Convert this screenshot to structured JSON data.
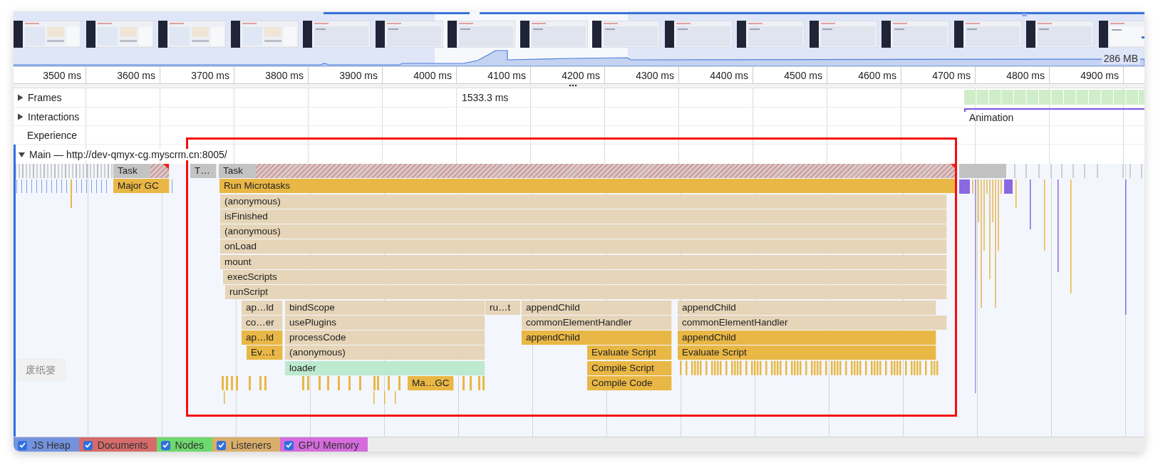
{
  "overview": {
    "thumbnails": [
      {
        "kind": "dashboard"
      },
      {
        "kind": "dashboard"
      },
      {
        "kind": "dashboard"
      },
      {
        "kind": "dashboard"
      },
      {
        "kind": "list"
      },
      {
        "kind": "list"
      },
      {
        "kind": "list"
      },
      {
        "kind": "list"
      },
      {
        "kind": "list"
      },
      {
        "kind": "list"
      },
      {
        "kind": "list"
      },
      {
        "kind": "list"
      },
      {
        "kind": "list"
      },
      {
        "kind": "list"
      },
      {
        "kind": "list"
      },
      {
        "kind": "detail"
      }
    ],
    "memory_reading": "286 MB"
  },
  "ruler": {
    "ticks": [
      "3500 ms",
      "3600 ms",
      "3700 ms",
      "3800 ms",
      "3900 ms",
      "4000 ms",
      "4100 ms",
      "4200 ms",
      "4300 ms",
      "4400 ms",
      "4500 ms",
      "4600 ms",
      "4700 ms",
      "4800 ms",
      "4900 ms"
    ]
  },
  "tracks": [
    {
      "label": "Frames",
      "kind": "frames",
      "expanded": false,
      "reading": "1533.3 ms"
    },
    {
      "label": "Interactions",
      "kind": "interactions",
      "expanded": false,
      "event": "Animation"
    },
    {
      "label": "Experience",
      "kind": "experience"
    }
  ],
  "main": {
    "title": "Main — http://dev-qmyx-cg.myscrm.cn:8005/",
    "expanded": true,
    "rows": [
      {
        "bars": [
          {
            "label": "Task",
            "kind": "task",
            "long": true
          },
          {
            "label": "T…",
            "kind": "task",
            "long": false
          },
          {
            "label": "Task",
            "kind": "task",
            "long": true
          }
        ]
      },
      {
        "bars": [
          {
            "label": "Major GC",
            "kind": "native"
          },
          {
            "label": "Run Microtasks",
            "kind": "native"
          }
        ]
      },
      {
        "bars": [
          {
            "label": "(anonymous)",
            "kind": "script"
          }
        ]
      },
      {
        "bars": [
          {
            "label": "isFinished",
            "kind": "script"
          }
        ]
      },
      {
        "bars": [
          {
            "label": "(anonymous)",
            "kind": "script"
          }
        ]
      },
      {
        "bars": [
          {
            "label": "onLoad",
            "kind": "script"
          }
        ]
      },
      {
        "bars": [
          {
            "label": "mount",
            "kind": "script"
          }
        ]
      },
      {
        "bars": [
          {
            "label": "execScripts",
            "kind": "script"
          }
        ]
      },
      {
        "bars": [
          {
            "label": "runScript",
            "kind": "script"
          }
        ]
      },
      {
        "bars": [
          {
            "label": "ap…ld",
            "kind": "script"
          },
          {
            "label": "bindScope",
            "kind": "script"
          },
          {
            "label": "ru…t",
            "kind": "script"
          },
          {
            "label": "appendChild",
            "kind": "script"
          },
          {
            "label": "appendChild",
            "kind": "script"
          }
        ]
      },
      {
        "bars": [
          {
            "label": "co…er",
            "kind": "script"
          },
          {
            "label": "usePlugins",
            "kind": "script"
          },
          {
            "label": "commonElementHandler",
            "kind": "script"
          },
          {
            "label": "commonElementHandler",
            "kind": "script"
          }
        ]
      },
      {
        "bars": [
          {
            "label": "ap…ld",
            "kind": "native"
          },
          {
            "label": "processCode",
            "kind": "script"
          },
          {
            "label": "appendChild",
            "kind": "native"
          },
          {
            "label": "appendChild",
            "kind": "native"
          }
        ]
      },
      {
        "bars": [
          {
            "label": "Ev…t",
            "kind": "native"
          },
          {
            "label": "(anonymous)",
            "kind": "script"
          },
          {
            "label": "Evaluate Script",
            "kind": "native"
          },
          {
            "label": "Evaluate Script",
            "kind": "native"
          }
        ]
      },
      {
        "bars": [
          {
            "label": "loader",
            "kind": "loader"
          },
          {
            "label": "Compile Script",
            "kind": "native"
          }
        ]
      },
      {
        "bars": [
          {
            "label": "Ma…GC",
            "kind": "native"
          },
          {
            "label": "Compile Code",
            "kind": "native"
          }
        ]
      }
    ]
  },
  "counters": [
    {
      "label": "JS Heap",
      "checked": true,
      "color": "#7393de"
    },
    {
      "label": "Documents",
      "checked": true,
      "color": "#d66b6b"
    },
    {
      "label": "Nodes",
      "checked": true,
      "color": "#6dd86d"
    },
    {
      "label": "Listeners",
      "checked": true,
      "color": "#d9ae6b"
    },
    {
      "label": "GPU Memory",
      "checked": true,
      "color": "#d56bdc"
    }
  ],
  "desktop_label": "废纸篓"
}
